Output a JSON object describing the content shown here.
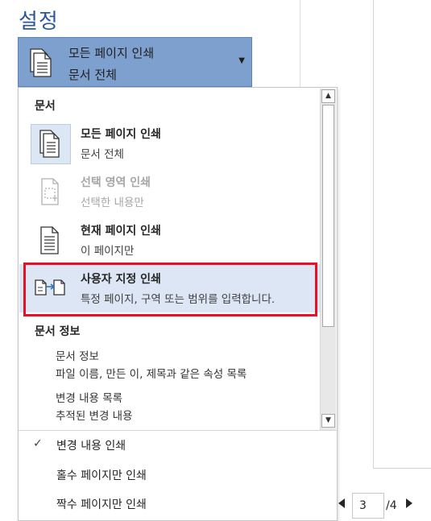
{
  "section_title": "설정",
  "dropdown": {
    "selected_title": "모든 페이지 인쇄",
    "selected_subtitle": "문서 전체",
    "groups": {
      "document": "문서",
      "document_info": "문서 정보"
    },
    "options": [
      {
        "title": "모든 페이지 인쇄",
        "subtitle": "문서 전체",
        "icon": "all-pages-icon",
        "state": "selected"
      },
      {
        "title": "선택 영역 인쇄",
        "subtitle": "선택한 내용만",
        "icon": "selection-icon",
        "state": "disabled"
      },
      {
        "title": "현재 페이지 인쇄",
        "subtitle": "이 페이지만",
        "icon": "current-page-icon",
        "state": "normal"
      },
      {
        "title": "사용자 지정 인쇄",
        "subtitle": "특정 페이지, 구역 또는 범위를 입력합니다.",
        "icon": "custom-print-icon",
        "state": "highlighted"
      }
    ],
    "info_items": [
      {
        "title": "문서 정보",
        "subtitle": "파일 이름, 만든 이, 제목과 같은 속성 목록"
      },
      {
        "title": "변경 내용 목록",
        "subtitle": "추적된 변경 내용"
      }
    ],
    "toggles": [
      {
        "label": "변경 내용 인쇄",
        "checked": true,
        "check_glyph": "✓"
      },
      {
        "label": "홀수 페이지만 인쇄",
        "checked": false
      },
      {
        "label": "짝수 페이지만 인쇄",
        "checked": false
      }
    ]
  },
  "pager": {
    "current": "3",
    "total": "/4"
  },
  "colors": {
    "accent": "#2b579a",
    "selected_bg": "#7da0cf",
    "highlight_bg": "#dce6f4",
    "callout": "#e81123"
  }
}
